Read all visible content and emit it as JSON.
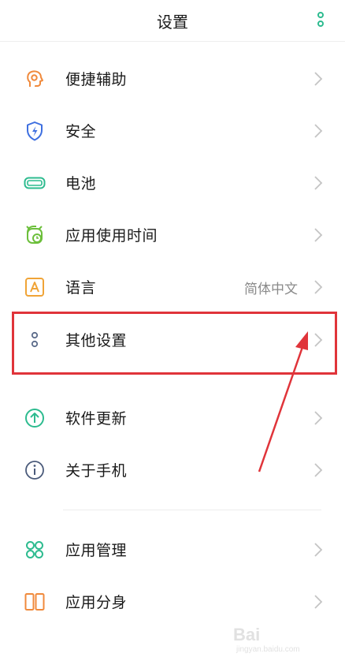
{
  "header": {
    "title": "设置",
    "more_icon": "vertical-dots-icon",
    "accent": "#2dbb8f"
  },
  "items": [
    {
      "label": "便捷辅助",
      "icon": "accessibility-icon"
    },
    {
      "label": "安全",
      "icon": "shield-icon"
    },
    {
      "label": "电池",
      "icon": "battery-icon"
    },
    {
      "label": "应用使用时间",
      "icon": "alarm-clock-icon"
    },
    {
      "label": "语言",
      "icon": "language-icon",
      "value": "简体中文"
    },
    {
      "label": "其他设置",
      "icon": "dots-icon"
    },
    {
      "label": "软件更新",
      "icon": "update-arrow-icon"
    },
    {
      "label": "关于手机",
      "icon": "info-icon"
    },
    {
      "label": "应用管理",
      "icon": "app-grid-icon"
    },
    {
      "label": "应用分身",
      "icon": "app-clone-icon"
    }
  ],
  "annotation": {
    "highlight_color": "#e0343a"
  },
  "watermark": {
    "text": "Bai",
    "sub": "jingyan.baidu.com"
  }
}
